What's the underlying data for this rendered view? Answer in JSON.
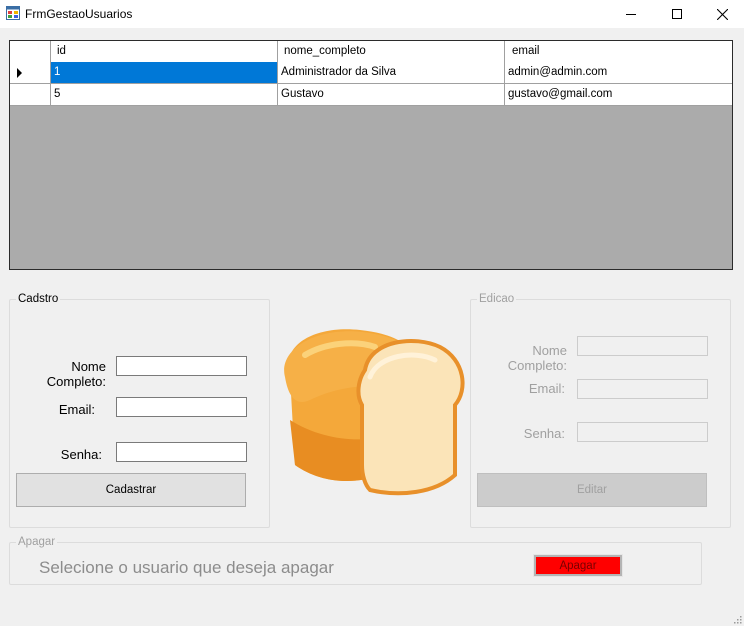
{
  "window": {
    "title": "FrmGestaoUsuarios"
  },
  "grid": {
    "columns": [
      "id",
      "nome_completo",
      "email"
    ],
    "rows": [
      {
        "id": "1",
        "nome_completo": "Administrador da Silva",
        "email": "admin@admin.com",
        "selected": true
      },
      {
        "id": "5",
        "nome_completo": "Gustavo",
        "email": "gustavo@gmail.com",
        "selected": false
      }
    ]
  },
  "cadastro": {
    "legend": "Cadstro",
    "nome_label": "Nome Completo:",
    "email_label": "Email:",
    "senha_label": "Senha:",
    "nome_value": "",
    "email_value": "",
    "senha_value": "",
    "button_label": "Cadastrar"
  },
  "edicao": {
    "legend": "Edicao",
    "nome_label": "Nome Completo:",
    "email_label": "Email:",
    "senha_label": "Senha:",
    "button_label": "Editar",
    "enabled": false
  },
  "apagar": {
    "legend": "Apagar",
    "message": "Selecione o usuario que deseja apagar",
    "button_label": "Apagar",
    "button_color": "#ff0000"
  },
  "colors": {
    "selection": "#0078d7",
    "grid_background": "#ababab",
    "window_background": "#f0f0f0"
  },
  "icons": {
    "app": "form-icon",
    "image": "bread-loaf-icon"
  }
}
